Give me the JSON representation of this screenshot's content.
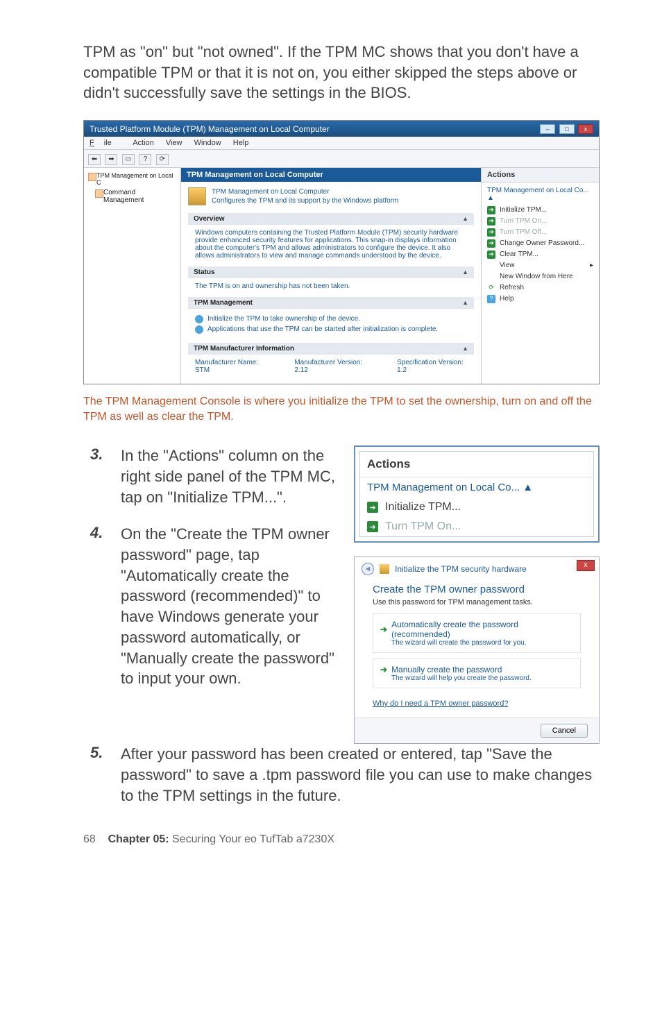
{
  "intro": "TPM as \"on\" but \"not owned\". If the TPM MC shows that you don't have a compatible TPM or that it is not on, you either skipped the steps above or didn't successfully save the settings in the BIOS.",
  "mmc": {
    "title": "Trusted Platform Module (TPM) Management on Local Computer",
    "menu": {
      "file": "File",
      "action": "Action",
      "view": "View",
      "window": "Window",
      "help": "Help"
    },
    "left": {
      "node1": "TPM Management on Local Computer",
      "node2": "Command Management"
    },
    "centerHead": "TPM Management on Local Computer",
    "confTitle": "TPM Management on Local Computer",
    "confSub": "Configures the TPM and its support by the Windows platform",
    "overview": "Overview",
    "overviewText": "Windows computers containing the Trusted Platform Module (TPM) security hardware provide enhanced security features for applications. This snap-in displays information about the computer's TPM and allows administrators to configure the device. It also allows administrators to view and manage commands understood by the device.",
    "status": "Status",
    "statusText": "The TPM is on and ownership has not been taken.",
    "mgmt": "TPM Management",
    "mgmt1": "Initialize the TPM to take ownership of the device.",
    "mgmt2": "Applications that use the TPM can be started after initialization is complete.",
    "manu": "TPM Manufacturer Information",
    "mName": "Manufacturer Name:  STM",
    "mVer": "Manufacturer Version:  2.12",
    "sVer": "Specification Version:  1.2",
    "actions": {
      "head": "Actions",
      "group": "TPM Management on Local Co...",
      "a1": "Initialize TPM...",
      "a2": "Turn TPM On...",
      "a3": "Turn TPM Off...",
      "a4": "Change Owner Password...",
      "a5": "Clear TPM...",
      "a6": "View",
      "a7": "New Window from Here",
      "a8": "Refresh",
      "a9": "Help"
    }
  },
  "caption": "The TPM Management Console is where you initialize the TPM to set the ownership, turn on and off the TPM as well as clear the TPM.",
  "step3num": "3.",
  "step3": "In the \"Actions\" column on the right side panel of the TPM MC, tap on \"Initialize TPM...\".",
  "step4num": "4.",
  "step4": "On the \"Create the TPM owner password\" page, tap \"Automatically create the password (recommended)\" to have Windows generate your password automatically, or \"Manually create the password\" to input your own.",
  "step5num": "5.",
  "step5": "After your password has been created or entered, tap \"Save the password\" to save a .tpm password file you can use to make changes to the TPM settings in the future.",
  "actionsBox": {
    "head": "Actions",
    "group": "TPM Management on Local Co...",
    "a1": "Initialize TPM...",
    "a2": "Turn TPM On..."
  },
  "wiz": {
    "title": "Initialize the TPM security hardware",
    "head": "Create the TPM owner password",
    "sub": "Use this password for TPM management tasks.",
    "opt1t": "Automatically create the password (recommended)",
    "opt1d": "The wizard will create the password for you.",
    "opt2t": "Manually create the password",
    "opt2d": "The wizard will help you create the password.",
    "link": "Why do I need a TPM owner password?",
    "cancel": "Cancel"
  },
  "footer": {
    "page": "68",
    "chapter": "Chapter 05:",
    "title": " Securing Your eo TufTab a7230X"
  }
}
